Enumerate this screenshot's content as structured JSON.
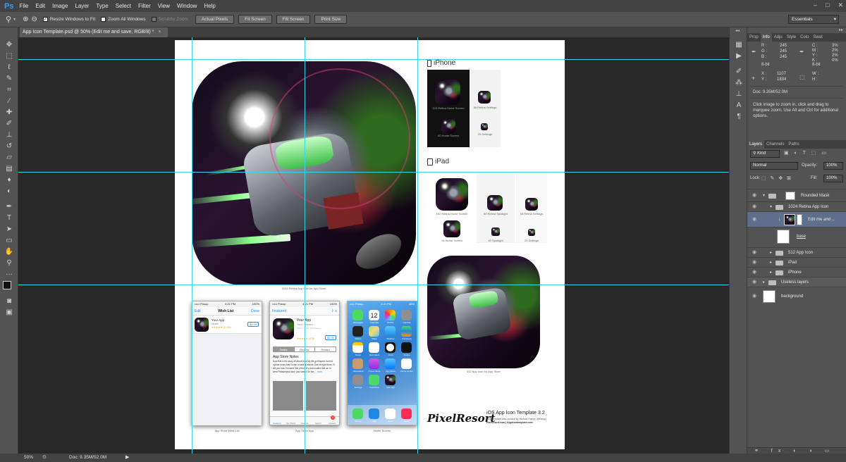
{
  "app": {
    "logo": "Ps"
  },
  "menu": [
    "File",
    "Edit",
    "Image",
    "Layer",
    "Type",
    "Select",
    "Filter",
    "View",
    "Window",
    "Help"
  ],
  "window_controls": [
    "–",
    "□",
    "✕"
  ],
  "options": {
    "resize_windows": "Resize Windows to Fit",
    "zoom_all": "Zoom All Windows",
    "scrubby_zoom": "Scrubby Zoom",
    "buttons": [
      "Actual Pixels",
      "Fit Screen",
      "Fill Screen",
      "Print Size"
    ],
    "workspace": "Essentials"
  },
  "document_tab": {
    "title": "App Icon Template.psd @ 50% (Edit me and save, RGB/8) *",
    "close": "×"
  },
  "document": {
    "iphone_label": "iPhone",
    "ipad_label": "iPad",
    "iphone_icons": [
      {
        "caption": "120 Retina Home Screen"
      },
      {
        "caption": "58 Retina Settings"
      },
      {
        "caption": "60 Home Screen"
      },
      {
        "caption": "29 Settings"
      }
    ],
    "ipad_icons": [
      {
        "caption": "152 Retina Home Screen"
      },
      {
        "caption": "80 Retina Spotlight"
      },
      {
        "caption": "58 Retina Settings"
      },
      {
        "caption": "76 Home Screen"
      },
      {
        "caption": "40 Spotlight"
      },
      {
        "caption": "29 Settings"
      }
    ],
    "big_icon_caption": "1024 Retina App Icon for App Store",
    "icon512_caption": "512 App Icon for App Store",
    "mock_captions": [
      "App Store Wish List",
      "App Store App",
      "Home Screen"
    ],
    "wishlist": {
      "carrier": "••••• Flarup",
      "time": "4:21 PM",
      "battery": "100%",
      "edit": "Edit",
      "title": "Wish List",
      "done": "Done",
      "app_name": "Your App",
      "app_category": "Health",
      "rating": "★★★★★ (1,234)",
      "price": "$0.99"
    },
    "appstore": {
      "carrier": "••••• Flarup",
      "time": "4:21 PM",
      "battery": "100%",
      "back": "Featured",
      "app_name": "Your App",
      "company": "Your Company >",
      "age": "Offers In-App Purchases",
      "rating": "★★★★★ (678)",
      "price": "$0.99",
      "tabs": [
        "Details",
        "Reviews",
        "Related"
      ],
      "notes_title": "App Store Notes",
      "notes_text": "Now this is the story all about how My life got flipped, turned upside down And I'd like to take a minute Just sit right there I'll tell you how I became the prince of a town called Bel air. In west Philadelphia born and raised On the ...",
      "more": "more",
      "bottom_tabs": [
        "Featured",
        "Top Charts",
        "Near Me",
        "Search",
        "Updates"
      ],
      "badge": "1"
    },
    "homescreen": {
      "carrier": "••••• Flarup",
      "time": "4:21 PM",
      "battery": "45%",
      "calendar_day": "Tuesday",
      "calendar_date": "12",
      "apps": [
        "Messages",
        "Calendar",
        "Photos",
        "Camera",
        "Videos",
        "Maps",
        "Weather",
        "Passbook",
        "Notes",
        "Reminders",
        "Clock",
        "Stocks",
        "Newsstand",
        "iTunes Store",
        "App Store",
        "Game Center",
        "Settings",
        "FaceTime",
        "Your app",
        ""
      ],
      "dock": [
        "Phone",
        "Mail",
        "Safari",
        "Music"
      ]
    },
    "brand": "PixelResort",
    "template_title": "iOS App Icon Template 3.2",
    "template_line1": "This template was created by Michael Flarup (@flarup)",
    "template_line2": "Pixelresort.com   |   Appicontemplate.com"
  },
  "panel_info": {
    "tabs": [
      "Prop",
      "Info",
      "Adju",
      "Style",
      "Colo",
      "Swat"
    ],
    "rgb": [
      [
        "R :",
        "245"
      ],
      [
        "G :",
        "245"
      ],
      [
        "B :",
        "245"
      ]
    ],
    "cmyk": [
      [
        "C :",
        "3%"
      ],
      [
        "M :",
        "2%"
      ],
      [
        "Y :",
        "2%"
      ],
      [
        "K :",
        "0%"
      ]
    ],
    "bit1": "8-bit",
    "bit2": "8-bit",
    "xy": [
      [
        "X :",
        "1107"
      ],
      [
        "Y :",
        "1834"
      ]
    ],
    "wh": [
      [
        "W :",
        ""
      ],
      [
        "H :",
        ""
      ]
    ],
    "doc": "Doc: 9.35M/52.0M",
    "hint": "Click image to zoom in, click and drag to marquee zoom.  Use Alt and Ctrl for additional options."
  },
  "layers_panel": {
    "tabs": [
      "Layers",
      "Channels",
      "Paths"
    ],
    "kind": "Kind",
    "blend": "Normal",
    "opacity_label": "Opacity:",
    "opacity": "100%",
    "lock_label": "Lock:",
    "fill_label": "Fill:",
    "fill": "100%",
    "layers": [
      "Rounded Mask",
      "1024 Retina App Icon",
      "Edit me and ...",
      "base",
      "512 App Icon",
      "iPad",
      "iPhone",
      "Useless layers",
      "background"
    ]
  },
  "status": {
    "zoom": "50%",
    "doc": "Doc: 9.35M/52.0M"
  },
  "colors": {
    "guide": "#38d6e6",
    "selected_layer": "#5d6f8a",
    "ps_blue": "#2fa3ff"
  }
}
